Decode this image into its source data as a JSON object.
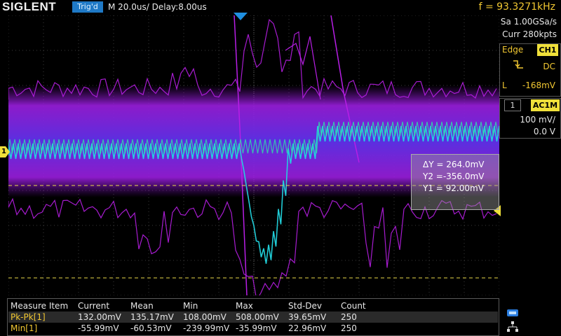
{
  "topbar": {
    "brand": "SIGLENT",
    "trigger_status": "Trig'd",
    "timebase": "M 20.0us/",
    "delay": "Delay:8.00us",
    "frequency": "f = 93.3271kHz"
  },
  "acquisition": {
    "sample_rate": "Sa 1.00GSa/s",
    "memory": "Curr 280kpts"
  },
  "trigger": {
    "type_label": "Edge",
    "source": "CH1",
    "slope_icon": "rising-edge-icon",
    "coupling": "DC",
    "level_label": "L",
    "level_value": "-168mV"
  },
  "channel": {
    "number": "1",
    "coupling": "AC1M",
    "scale": "100 mV/",
    "offset": "0.0 V"
  },
  "cursor_readout": {
    "dy": "ΔY = 264.0mV",
    "y2": "Y2 =-356.0mV",
    "y1": "Y1 = 92.00mV"
  },
  "measure_table": {
    "headers": [
      "Measure Item",
      "Current",
      "Mean",
      "Min",
      "Max",
      "Std-Dev",
      "Count"
    ],
    "rows": [
      [
        "Pk-Pk[1]",
        "132.00mV",
        "135.17mV",
        "108.00mV",
        "508.00mV",
        "39.65mV",
        "250"
      ],
      [
        "Min[1]",
        "-55.99mV",
        "-60.53mV",
        "-239.99mV",
        "-35.99mV",
        "22.96mV",
        "250"
      ]
    ]
  },
  "markers": {
    "channel_ground": "1"
  },
  "colors": {
    "accent_yellow": "#f0e03a",
    "trigd_blue": "#1f79c6",
    "freq_yellow": "#f2c832",
    "trace_magenta": "#b81ee6",
    "trace_cyan": "#22d6e0"
  },
  "icons": {
    "usb": "usb-icon",
    "network": "network-icon"
  }
}
